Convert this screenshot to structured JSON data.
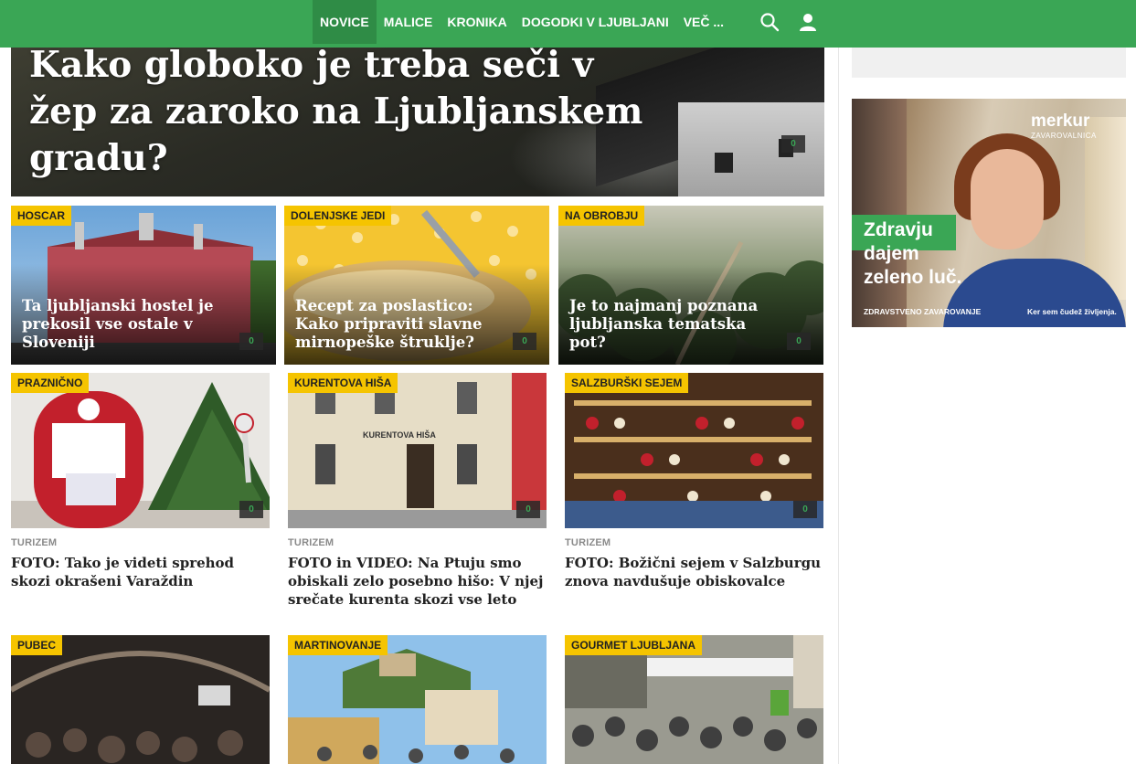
{
  "nav": {
    "items": [
      "NOVICE",
      "MALICE",
      "KRONIKA",
      "DOGODKI V LJUBLJANI",
      "VEČ ..."
    ],
    "active": "NOVICE",
    "icons": [
      "search-icon",
      "user-icon"
    ],
    "color": "#3aa655"
  },
  "hero": {
    "title": "Kako globoko je treba seči v žep za zaroko na Ljubljanskem gradu?",
    "comments": "0"
  },
  "row1": [
    {
      "tag": "HOSCAR",
      "title": "Ta ljubljanski hostel je prekosil vse ostale v Sloveniji",
      "comments": "0"
    },
    {
      "tag": "DOLENJSKE JEDI",
      "title": "Recept za poslastico: Kako pripraviti slavne mirnopeške štruklje?",
      "comments": "0"
    },
    {
      "tag": "NA OBROBJU",
      "title": "Je to najmanj poznana ljubljanska tematska pot?",
      "comments": "0"
    }
  ],
  "row2": [
    {
      "tag": "PRAZNIČNO",
      "section": "TURIZEM",
      "title": "FOTO: Tako je videti sprehod skozi okrašeni Varaždin",
      "comments": "0"
    },
    {
      "tag": "KURENTOVA HIŠA",
      "section": "TURIZEM",
      "title": "FOTO in VIDEO: Na Ptuju smo obiskali zelo posebno hišo: V njej srečate kurenta skozi vse leto",
      "comments": "0",
      "sign": "KURENTOVA HIŠA"
    },
    {
      "tag": "SALZBURŠKI SEJEM",
      "section": "TURIZEM",
      "title": "FOTO: Božični sejem v Salzburgu znova navdušuje obiskovalce",
      "comments": "0"
    }
  ],
  "row3": [
    {
      "tag": "PUBEC"
    },
    {
      "tag": "MARTINOVANJE"
    },
    {
      "tag": "GOURMET LJUBLJANA"
    }
  ],
  "ad": {
    "brand": "merkur",
    "brand_sub": "ZAVAROVALNICA",
    "slogan_1": "Zdravju",
    "slogan_2": "dajem",
    "slogan_3": "zeleno luč.",
    "footer_left": "ZDRAVSTVENO ZAVAROVANJE",
    "footer_right": "Ker sem čudež življenja."
  },
  "colors": {
    "accent": "#3aa655",
    "tag": "#f5c400"
  }
}
